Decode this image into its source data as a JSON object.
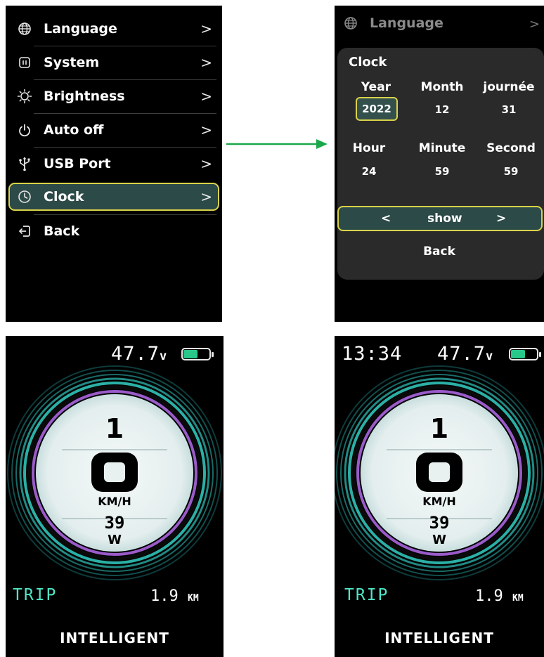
{
  "menu": {
    "items": [
      {
        "label": "Language",
        "icon": "globe-icon"
      },
      {
        "label": "System",
        "icon": "system-icon"
      },
      {
        "label": "Brightness",
        "icon": "brightness-icon"
      },
      {
        "label": "Auto off",
        "icon": "power-icon"
      },
      {
        "label": "USB Port",
        "icon": "usb-icon"
      },
      {
        "label": "Clock",
        "icon": "clock-icon",
        "selected": true
      },
      {
        "label": "Back",
        "icon": "back-icon"
      }
    ],
    "chevron": ">"
  },
  "clock_screen": {
    "behind_label": "Language",
    "title": "Clock",
    "fields": [
      {
        "label": "Year",
        "value": "2022",
        "selected": true
      },
      {
        "label": "Month",
        "value": "12"
      },
      {
        "label": "journée",
        "value": "31"
      },
      {
        "label": "Hour",
        "value": "24"
      },
      {
        "label": "Minute",
        "value": "59"
      },
      {
        "label": "Second",
        "value": "59"
      }
    ],
    "show_option": {
      "prev": "<",
      "label": "show",
      "next": ">"
    },
    "back_label": "Back"
  },
  "dashboard_without_clock": {
    "voltage": "47.7",
    "voltage_unit": "v",
    "gear": "1",
    "speed": "0",
    "speed_unit": "KM/H",
    "power": "39",
    "power_unit": "W",
    "trip_label": "TRIP",
    "trip_distance": "1.9",
    "trip_unit": "KM",
    "mode": "INTELLIGENT",
    "battery_level": 0.55
  },
  "dashboard_with_clock": {
    "time": "13:34",
    "voltage": "47.7",
    "voltage_unit": "v",
    "gear": "1",
    "speed": "0",
    "speed_unit": "KM/H",
    "power": "39",
    "power_unit": "W",
    "trip_label": "TRIP",
    "trip_distance": "1.9",
    "trip_unit": "KM",
    "mode": "INTELLIGENT",
    "battery_level": 0.55
  },
  "colors": {
    "selection_border": "#d9d24a",
    "selection_fill": "#2c4a48",
    "arrow": "#1aa84a",
    "trip_accent": "#4ee6c6",
    "battery": "#27c88a",
    "ring_accent": "#9a5bc9"
  }
}
